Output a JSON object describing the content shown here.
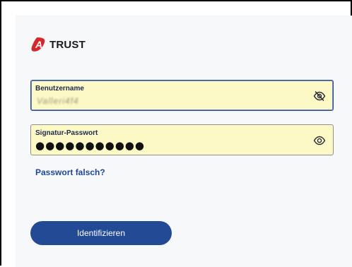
{
  "brand": {
    "logo_text": "TRUST",
    "logo_mark_letter": "A",
    "logo_color": "#d4262b"
  },
  "form": {
    "username": {
      "label": "Benutzername",
      "value_obscured": "Valleri4f4",
      "visibility_icon": "eye-slash-icon"
    },
    "password": {
      "label": "Signatur-Passwort",
      "value": "●●●●●●●●●●●",
      "visibility_icon": "eye-icon"
    },
    "forgot_link": "Passwort falsch?",
    "submit_label": "Identifizieren"
  },
  "colors": {
    "field_background": "#fdf9c6",
    "accent": "#234a95",
    "link": "#1f4699"
  }
}
